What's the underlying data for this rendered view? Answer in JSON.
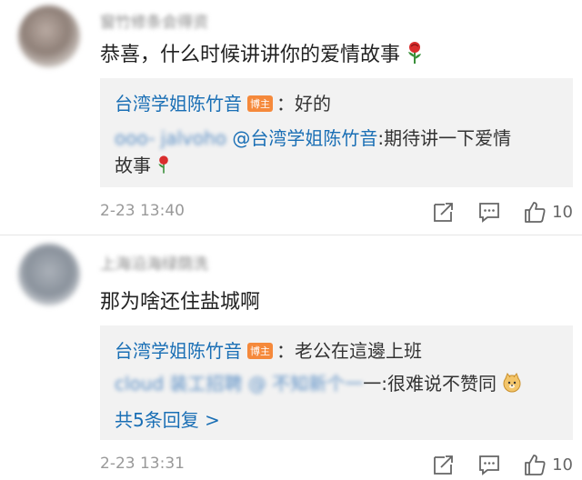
{
  "comments": [
    {
      "username": "窗竹修条会得资",
      "text": "恭喜，什么时候讲讲你的爱情故事",
      "replies": {
        "first_author": "台湾学姐陈竹音",
        "badge": "博主",
        "first_text": "：好的",
        "second_author": "ooo- jalvoho",
        "mention": "@台湾学姐陈竹音",
        "second_text": ":期待讲一下爱情",
        "second_text_cont": "故事"
      },
      "time": "2-23 13:40",
      "likes": "10"
    },
    {
      "username": "上海沿海绿荫洗",
      "text": "那为啥还住盐城啊",
      "replies": {
        "first_author": "台湾学姐陈竹音",
        "badge": "博主",
        "first_text": "：老公在這邊上班",
        "second_author": "cloud 装工招聘 @ 不知新个一",
        "second_text": "一:很难说不赞同",
        "more": "共5条回复 >"
      },
      "time": "2-23 13:31",
      "likes": "10"
    }
  ],
  "icons": {
    "share": "share-icon",
    "comment": "comment-icon",
    "like": "thumbs-up-icon",
    "rose": "rose-emoji",
    "doge": "doge-emoji"
  },
  "colors": {
    "link": "#1a6fb5",
    "badge": "#f5893b",
    "reply_bg": "#f2f2f2",
    "meta": "#999999"
  }
}
